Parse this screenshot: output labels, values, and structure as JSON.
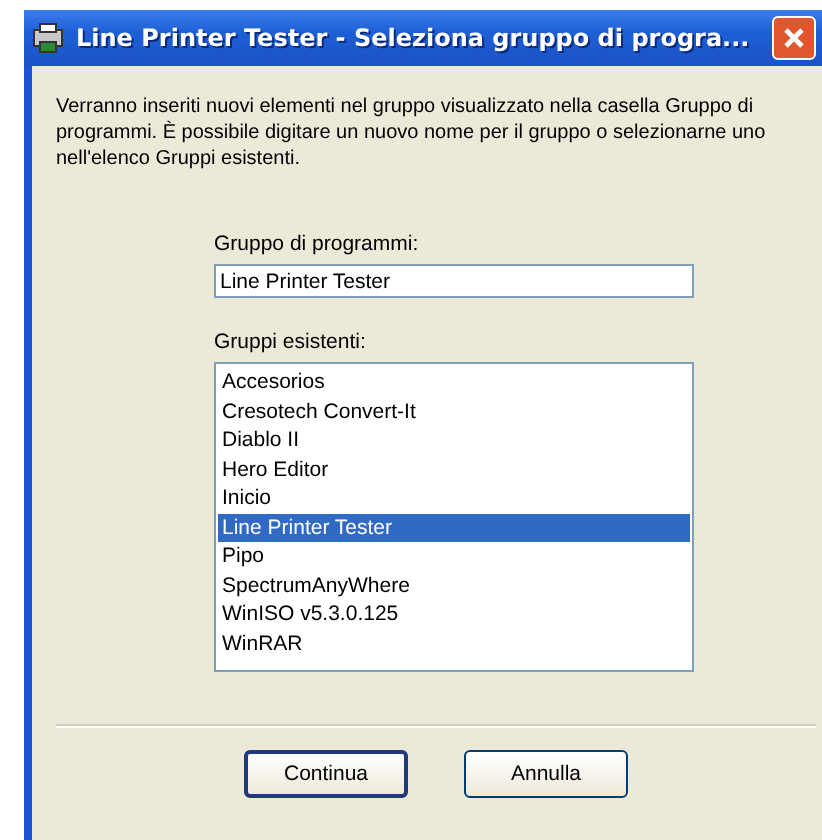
{
  "window": {
    "title": "Line Printer Tester - Seleziona gruppo di progra..."
  },
  "description": "Verranno inseriti nuovi elementi nel gruppo visualizzato nella casella Gruppo di programmi. È possibile digitare un nuovo nome per il gruppo o selezionarne uno nell'elenco Gruppi esistenti.",
  "group_field": {
    "label": "Gruppo di programmi:",
    "value": "Line Printer Tester"
  },
  "existing_groups": {
    "label": "Gruppi esistenti:",
    "items": [
      {
        "label": "Accesorios",
        "selected": false
      },
      {
        "label": "Cresotech Convert-It",
        "selected": false
      },
      {
        "label": "Diablo II",
        "selected": false
      },
      {
        "label": "Hero Editor",
        "selected": false
      },
      {
        "label": "Inicio",
        "selected": false
      },
      {
        "label": "Line Printer Tester",
        "selected": true
      },
      {
        "label": "Pipo",
        "selected": false
      },
      {
        "label": "SpectrumAnyWhere",
        "selected": false
      },
      {
        "label": "WinISO v5.3.0.125",
        "selected": false
      },
      {
        "label": "WinRAR",
        "selected": false
      }
    ]
  },
  "buttons": [
    {
      "label": "Continua",
      "default": true
    },
    {
      "label": "Annulla",
      "default": false
    }
  ]
}
